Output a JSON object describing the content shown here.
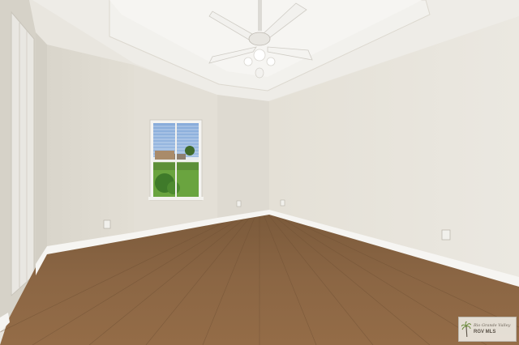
{
  "scene": {
    "room": "empty bedroom",
    "features": [
      "tray ceiling",
      "ceiling fan with light",
      "double-hung window",
      "hardwood floor",
      "white baseboards",
      "closet door"
    ]
  },
  "watermark": {
    "brand": "Rio Grande Valley",
    "mls": "RGV MLS",
    "logo_icon": "palm-tree-icon"
  },
  "colors": {
    "wall": "#e6e2d9",
    "ceiling": "#eeece7",
    "floor": "#8a6543",
    "trim": "#f4f3ef"
  }
}
